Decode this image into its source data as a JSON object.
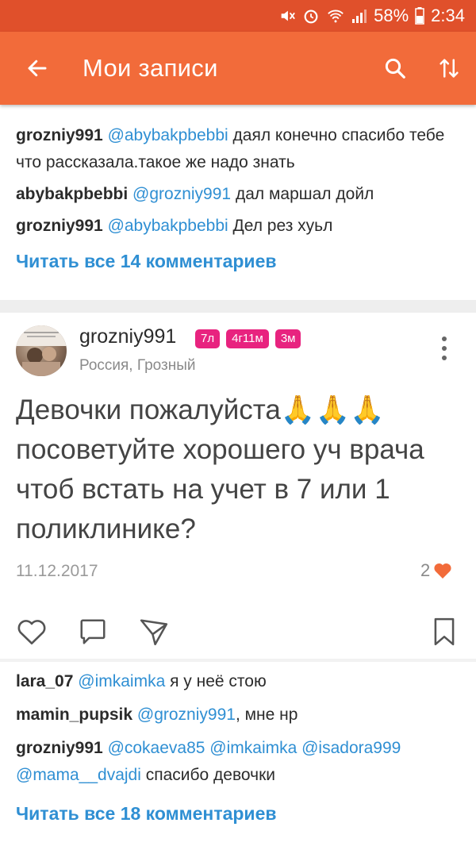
{
  "status_bar": {
    "battery": "58%",
    "time": "2:34"
  },
  "app_bar": {
    "title": "Мои записи"
  },
  "prev_comments": [
    {
      "user": "grozniy991",
      "mention": "@abybakpbebbi",
      "text": "даял конечно спасибо тебе что рассказала.такое же надо знать"
    },
    {
      "user": "abybakpbebbi",
      "mention": "@grozniy991",
      "text": "дал маршал дойл"
    },
    {
      "user": "grozniy991",
      "mention": "@abybakpbebbi",
      "text": "Дел рез хуьл"
    }
  ],
  "prev_read_all": "Читать все 14 комментариев",
  "post": {
    "author": "grozniy991",
    "badges": [
      "7л",
      "4г11м",
      "3м"
    ],
    "location": "Россия, Грозный",
    "text": "Девочки пожалуйста🙏🙏🙏 посоветуйте хорошего уч врача чтоб встать на учет в 7 или 1 поликлинике?",
    "date": "11.12.2017",
    "likes": "2"
  },
  "comments": [
    {
      "user": "lara_07",
      "mentions": "@imkaimka",
      "text": "я у неё стою"
    },
    {
      "user": "mamin_pupsik",
      "mentions": "@grozniy991",
      "text": ", мне нр"
    },
    {
      "user": "grozniy991",
      "mentions": "@cokaeva85 @imkaimka @isadora999 @mama__dvajdi",
      "text": "спасибо девочки"
    }
  ],
  "read_all": "Читать все 18 комментариев"
}
